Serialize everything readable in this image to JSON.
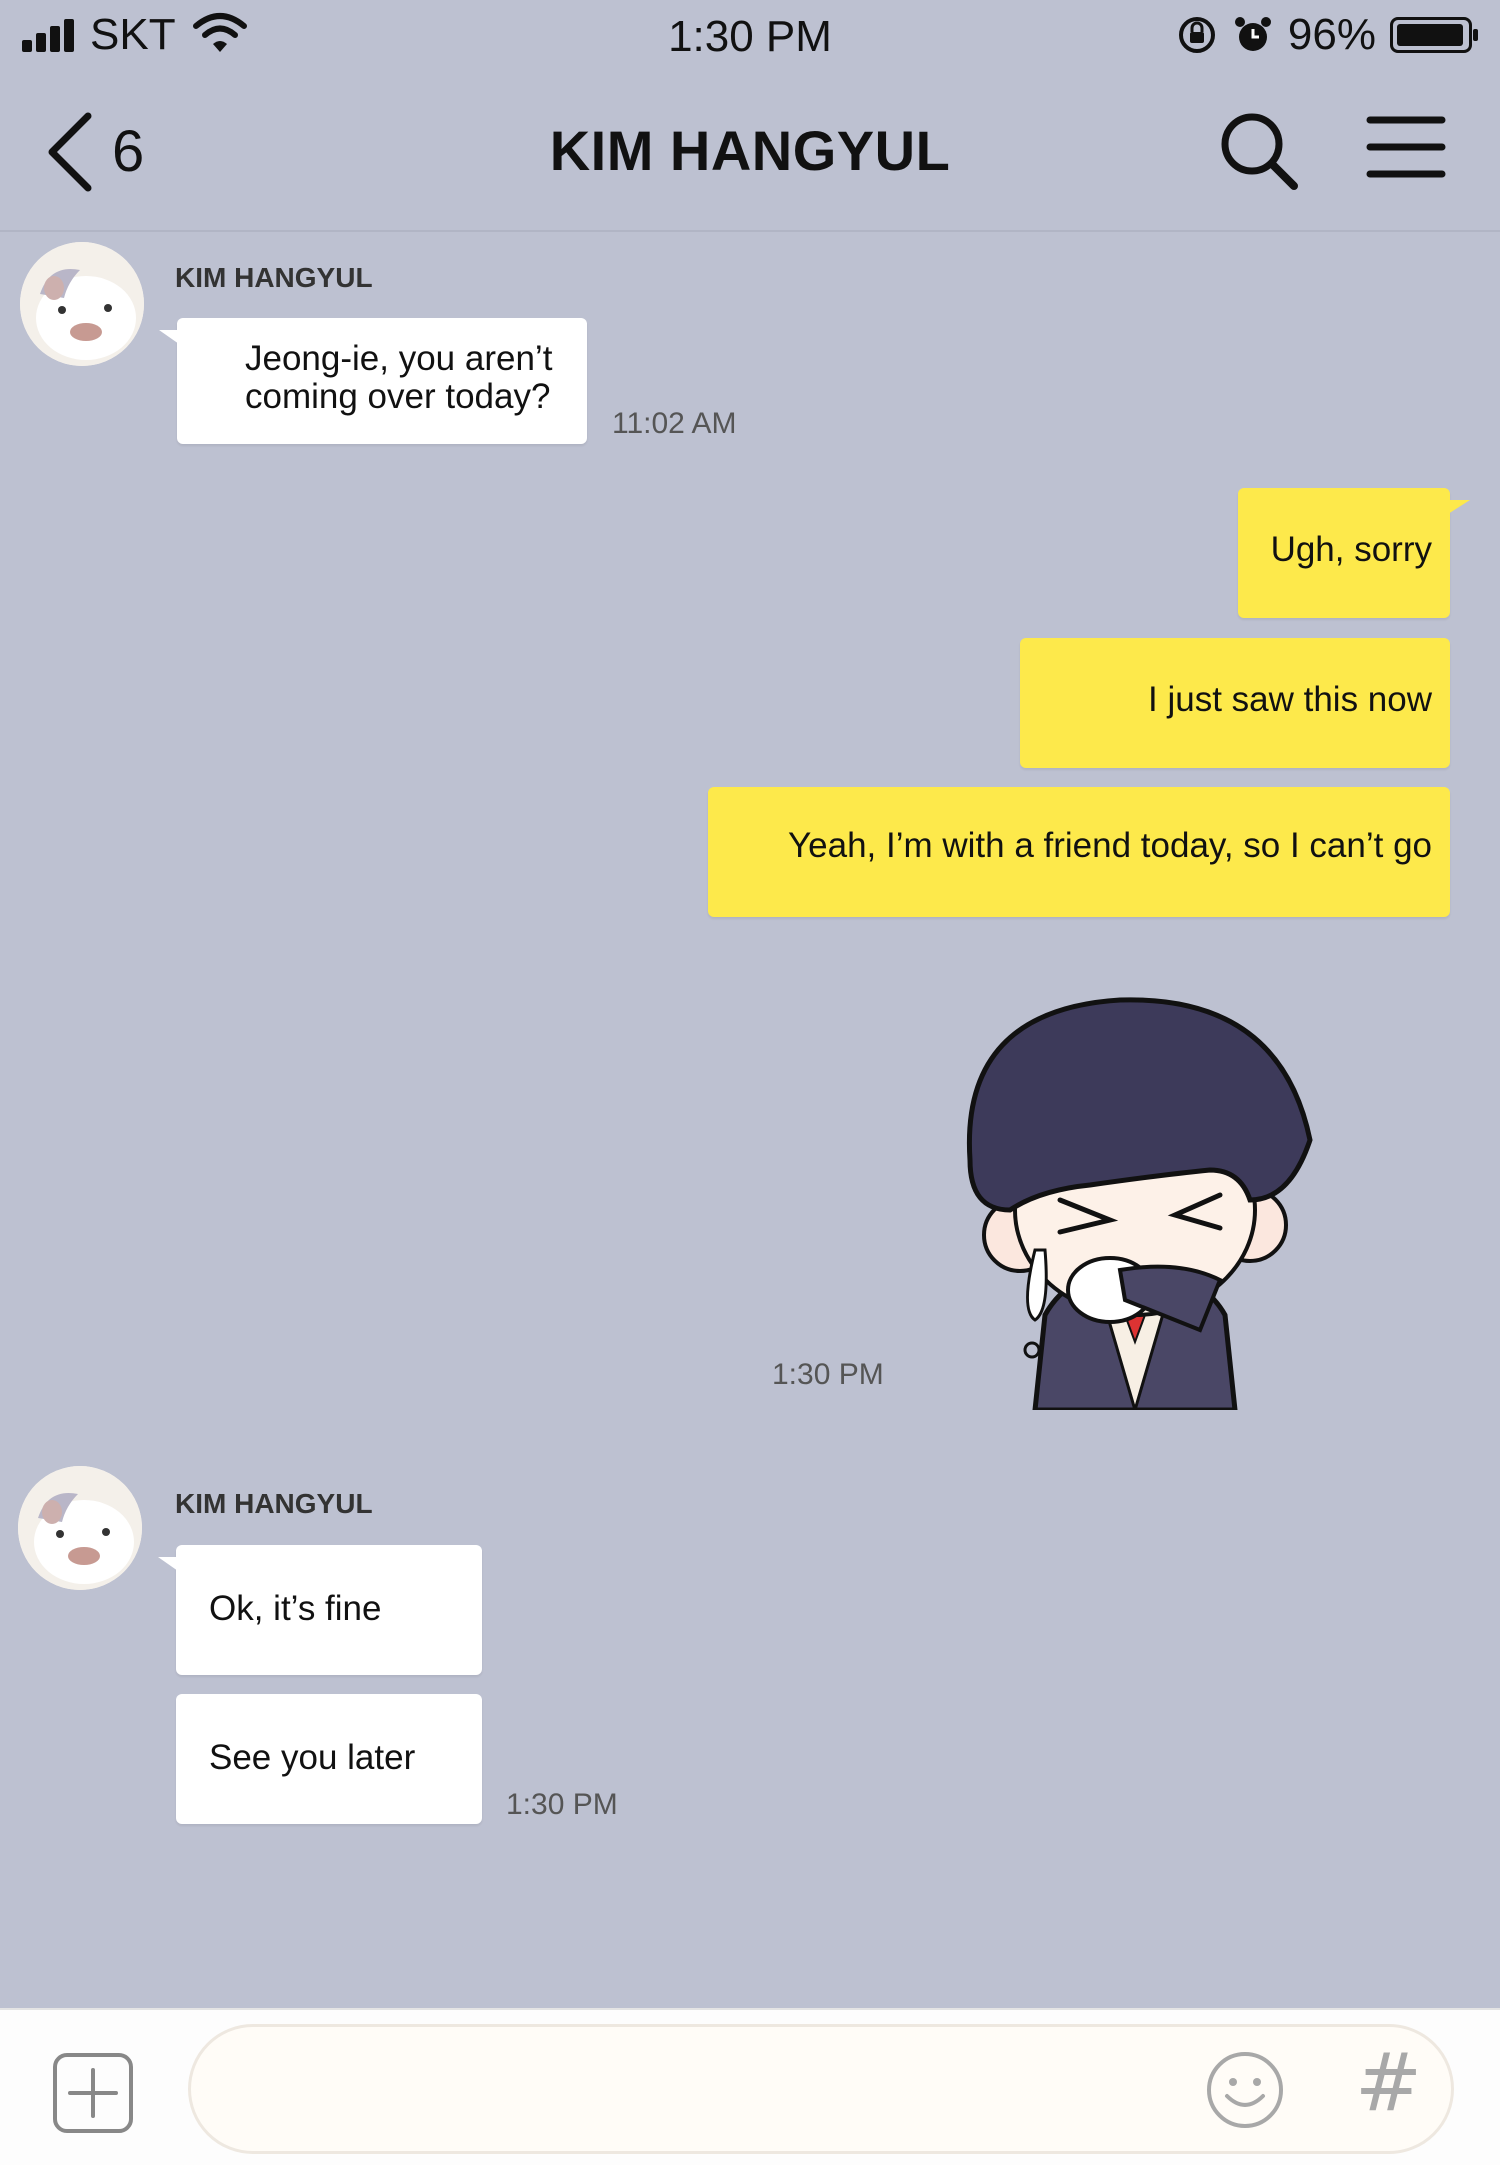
{
  "status_bar": {
    "carrier": "SKT",
    "time": "1:30 PM",
    "battery_percent": "96%",
    "icons": [
      "signal-icon",
      "wifi-icon",
      "orientation-lock-icon",
      "alarm-icon",
      "battery-icon"
    ]
  },
  "header": {
    "back_count": "6",
    "title": "KIM HANGYUL",
    "icons": [
      "back-chevron-icon",
      "search-icon",
      "menu-icon"
    ]
  },
  "messages": [
    {
      "sender": "KIM HANGYUL",
      "bubbles": [
        "Jeong-ie, you aren’t",
        "coming over today?"
      ],
      "time": "11:02 AM"
    },
    {
      "sender": "me",
      "bubbles": [
        "Ugh, sorry",
        "I just saw this now",
        "Yeah, I’m with a friend today, so I can’t go"
      ]
    },
    {
      "sender": "me",
      "sticker": "crying-boy-sticker",
      "time": "1:30 PM"
    },
    {
      "sender": "KIM HANGYUL",
      "bubbles": [
        "Ok, it’s fine",
        "See you later"
      ],
      "time": "1:30 PM"
    }
  ],
  "input_bar": {
    "message_value": "",
    "hash_symbol": "#",
    "icons": [
      "plus-icon",
      "emoji-icon",
      "hashtag-icon"
    ]
  },
  "colors": {
    "background": "#bdc1d1",
    "my_bubble": "#fde94b",
    "their_bubble": "#ffffff"
  }
}
